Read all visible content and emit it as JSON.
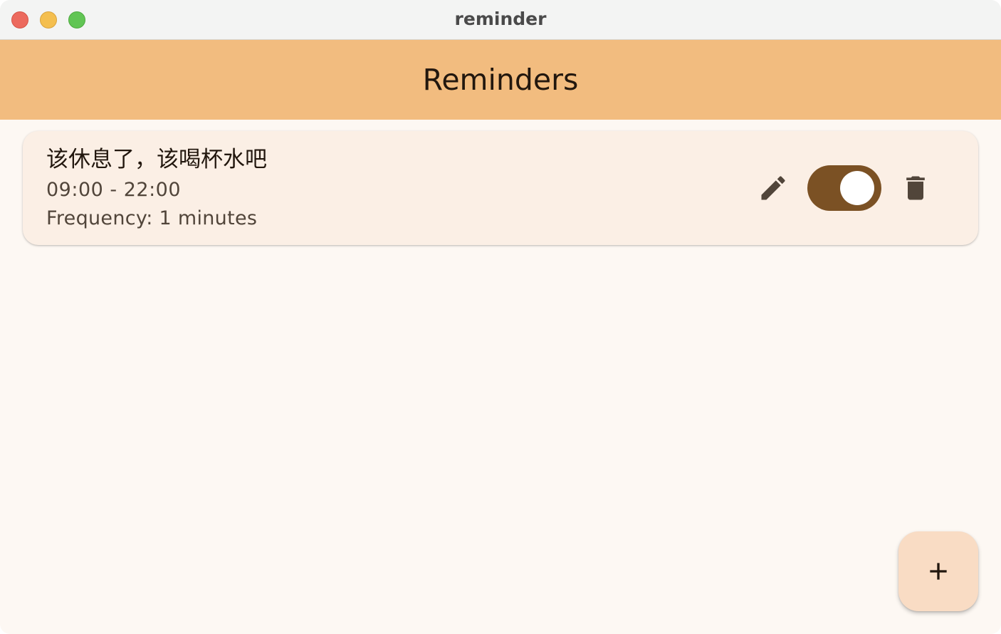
{
  "window": {
    "title": "reminder",
    "controls": [
      "close",
      "minimize",
      "maximize"
    ]
  },
  "appbar": {
    "title": "Reminders",
    "background": "#f2bc7f"
  },
  "reminders": [
    {
      "title": "该休息了，该喝杯水吧",
      "time_range": "09:00 - 22:00",
      "frequency": "Frequency: 1 minutes",
      "enabled": true,
      "actions": [
        "pencil-icon",
        "toggle-switch",
        "trash-icon"
      ]
    }
  ],
  "fab": {
    "icon": "plus-icon"
  },
  "colors": {
    "accent": "#7b5124",
    "card_background": "#fbefe5",
    "page_background": "#fdf8f3",
    "fab_background": "#f9dcc4",
    "icon": "#51453a"
  }
}
